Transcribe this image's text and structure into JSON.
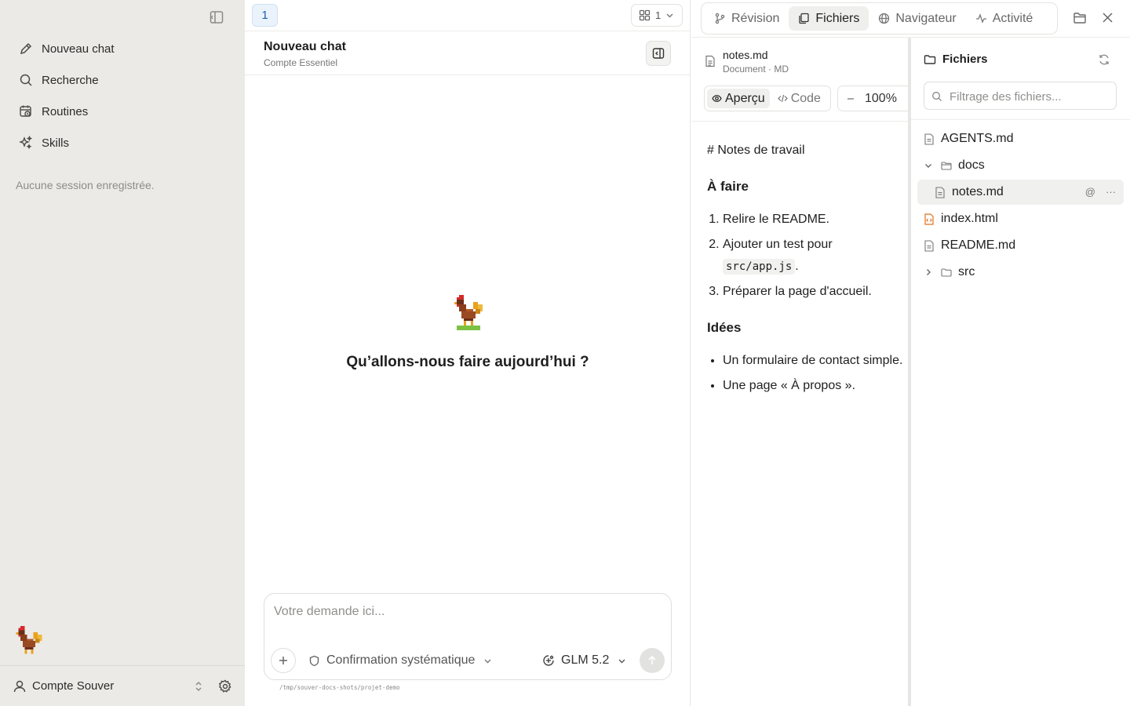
{
  "sidebar": {
    "items": [
      {
        "label": "Nouveau chat",
        "icon": "pencil-icon"
      },
      {
        "label": "Recherche",
        "icon": "search-icon"
      },
      {
        "label": "Routines",
        "icon": "calendar-clock-icon"
      },
      {
        "label": "Skills",
        "icon": "sparkle-icon"
      }
    ],
    "empty_label": "Aucune session enregistrée.",
    "account_name": "Compte Souver"
  },
  "chat": {
    "tab_number": "1",
    "layout_count": "1",
    "title": "Nouveau chat",
    "subtitle": "Compte Essentiel",
    "welcome": "Qu’allons-nous faire aujourd’hui ?",
    "composer": {
      "placeholder": "Votre demande ici...",
      "permission_label": "Confirmation systématique",
      "model_label": "GLM 5.2"
    },
    "cwd": "/tmp/souver-docs-shots/projet-demo"
  },
  "right_panel": {
    "tabs": [
      {
        "label": "Révision",
        "icon": "git-branch-icon",
        "active": false
      },
      {
        "label": "Fichiers",
        "icon": "files-icon",
        "active": true
      },
      {
        "label": "Navigateur",
        "icon": "globe-icon",
        "active": false
      },
      {
        "label": "Activité",
        "icon": "activity-icon",
        "active": false
      }
    ],
    "preview": {
      "file_name": "notes.md",
      "file_type": "Document · MD",
      "view_preview": "Aperçu",
      "view_code": "Code",
      "zoom": "100%",
      "doc": {
        "h1": "# Notes de travail",
        "section1": "À faire",
        "todo1": "Relire le README.",
        "todo2_text": "Ajouter un test pour",
        "todo2_code": "src/app.js",
        "todo2_end": ".",
        "todo3": "Préparer la page d'accueil.",
        "section2": "Idées",
        "idea1": "Un formulaire de contact simple.",
        "idea2": "Une page « À propos »."
      }
    },
    "files": {
      "title": "Fichiers",
      "filter_placeholder": "Filtrage des fichiers...",
      "tree": [
        {
          "name": "AGENTS.md",
          "kind": "file"
        },
        {
          "name": "docs",
          "kind": "folder-open"
        },
        {
          "name": "notes.md",
          "kind": "file",
          "selected": true
        },
        {
          "name": "index.html",
          "kind": "html"
        },
        {
          "name": "README.md",
          "kind": "file"
        },
        {
          "name": "src",
          "kind": "folder-closed"
        }
      ],
      "row_actions": {
        "mention": "@",
        "more": "···"
      }
    }
  },
  "colors": {
    "sidebar_bg": "#ebeae7",
    "accent_tab": "#1f5fa8",
    "html_icon": "#e2701f"
  }
}
